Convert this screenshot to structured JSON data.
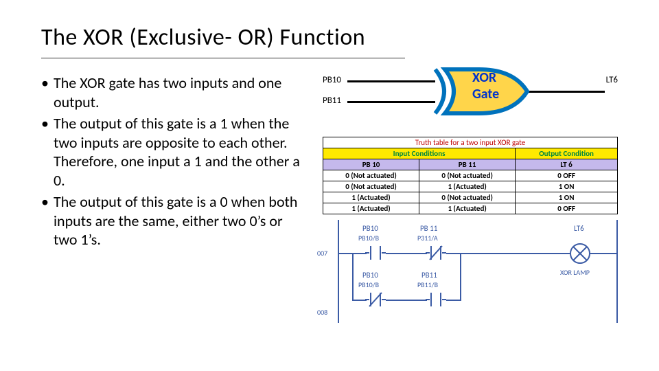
{
  "title": "The XOR (Exclusive- OR) Function",
  "bullets": [
    "The XOR gate has two inputs and one output.",
    "The output of this gate is a 1 when the two inputs are opposite to each other. Therefore, one input a 1 and the other a 0.",
    "The output of this gate is a 0 when both inputs are the same, either two 0’s or two 1’s."
  ],
  "gate": {
    "in_top": "PB10",
    "in_bot": "PB11",
    "label1": "XOR",
    "label2": "Gate",
    "out": "LT6"
  },
  "truth_table": {
    "title": "Truth table for a two input XOR gate",
    "input_hdr": "Input Conditions",
    "output_hdr": "Output Condition",
    "cols": [
      "PB 10",
      "PB 11",
      "LT 6"
    ],
    "rows": [
      [
        "0 (Not actuated)",
        "0 (Not actuated)",
        "0 OFF"
      ],
      [
        "0 (Not actuated)",
        "1 (Actuated)",
        "1 ON"
      ],
      [
        "1 (Actuated)",
        "0 (Not actuated)",
        "1 ON"
      ],
      [
        "1 (Actuated)",
        "1 (Actuated)",
        "0 OFF"
      ]
    ]
  },
  "ladder": {
    "rung1": "007",
    "rung2": "008",
    "c1a_top": "PB10",
    "c1a_bot": "PB10/B",
    "c1b_top": "PB 11",
    "c1b_bot": "P311/A",
    "c2a_top": "PB10",
    "c2a_bot": "PB10/B",
    "c2b_top": "PB11",
    "c2b_bot": "PB11/B",
    "lamp_top": "LT6",
    "lamp_caption": "XOR  LAMP"
  }
}
